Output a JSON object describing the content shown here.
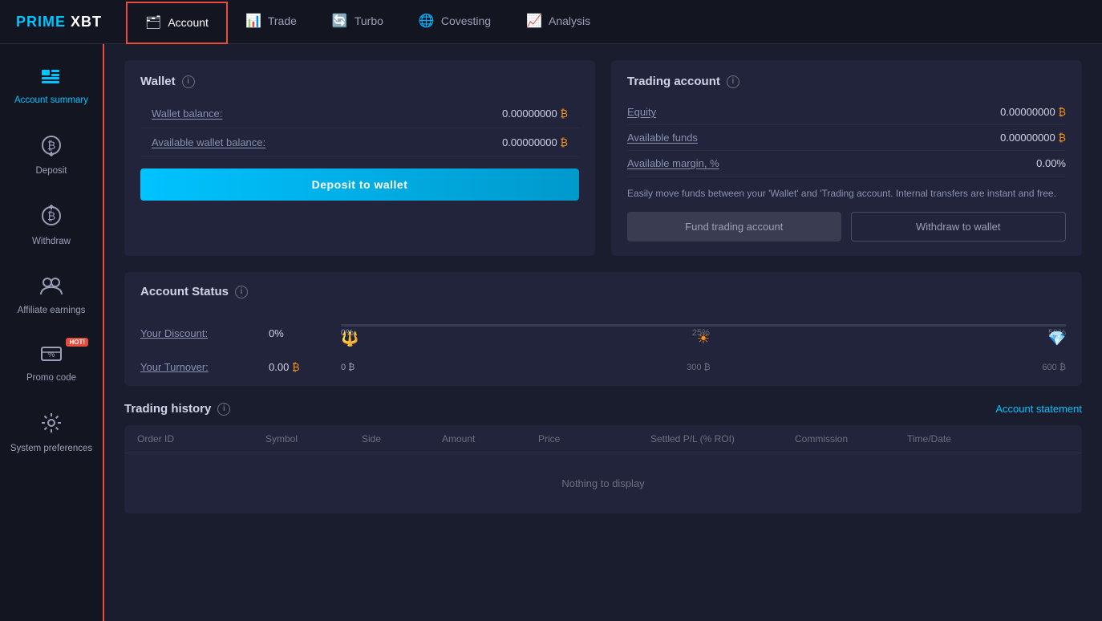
{
  "logo": {
    "prime": "PRIME",
    "xbt": " XBT"
  },
  "nav": {
    "items": [
      {
        "id": "account",
        "label": "Account",
        "icon": "🗂",
        "active": true
      },
      {
        "id": "trade",
        "label": "Trade",
        "icon": "📊",
        "active": false
      },
      {
        "id": "turbo",
        "label": "Turbo",
        "icon": "🔄",
        "active": false
      },
      {
        "id": "covesting",
        "label": "Covesting",
        "icon": "🌐",
        "active": false
      },
      {
        "id": "analysis",
        "label": "Analysis",
        "icon": "📈",
        "active": false
      }
    ]
  },
  "sidebar": {
    "items": [
      {
        "id": "account-summary",
        "label": "Account\nsummary",
        "icon": "🗃",
        "active": true
      },
      {
        "id": "deposit",
        "label": "Deposit",
        "icon": "⬇",
        "active": false
      },
      {
        "id": "withdraw",
        "label": "Withdraw",
        "icon": "⬆",
        "active": false
      },
      {
        "id": "affiliate",
        "label": "Affiliate\nearnings",
        "icon": "👥",
        "active": false
      },
      {
        "id": "promo",
        "label": "Promo code",
        "icon": "🏷",
        "active": false,
        "hot": true
      },
      {
        "id": "system",
        "label": "System\npreferences",
        "icon": "⚙",
        "active": false
      }
    ]
  },
  "wallet": {
    "title": "Wallet",
    "wallet_balance_label": "Wallet balance:",
    "wallet_balance_value": "0.00000000",
    "available_wallet_label": "Available wallet balance:",
    "available_wallet_value": "0.00000000",
    "deposit_btn": "Deposit to wallet",
    "btc_symbol": "₿"
  },
  "trading_account": {
    "title": "Trading account",
    "equity_label": "Equity",
    "equity_value": "0.00000000",
    "available_funds_label": "Available funds",
    "available_funds_value": "0.00000000",
    "available_margin_label": "Available margin, %",
    "available_margin_value": "0.00%",
    "transfer_note": "Easily move funds between your 'Wallet' and 'Trading account. Internal transfers are instant and free.",
    "fund_btn": "Fund trading account",
    "withdraw_btn": "Withdraw to wallet",
    "btc_symbol": "₿"
  },
  "account_status": {
    "title": "Account Status",
    "discount_label": "Your Discount:",
    "discount_value": "0%",
    "turnover_label": "Your Turnover:",
    "turnover_value": "0.00",
    "progress_levels": [
      {
        "pct": "0%",
        "btc": "0 ₿",
        "highlight": false
      },
      {
        "pct": "25%",
        "btc": "300 ₿",
        "highlight": false
      },
      {
        "pct": "50%",
        "btc": "600 ₿",
        "highlight": false
      }
    ]
  },
  "trading_history": {
    "title": "Trading history",
    "account_stmt": "Account statement",
    "columns": [
      "Order ID",
      "Symbol",
      "Side",
      "Amount",
      "Price",
      "Settled P/L (% ROI)",
      "Commission",
      "Time/Date"
    ],
    "empty_msg": "Nothing to display"
  }
}
